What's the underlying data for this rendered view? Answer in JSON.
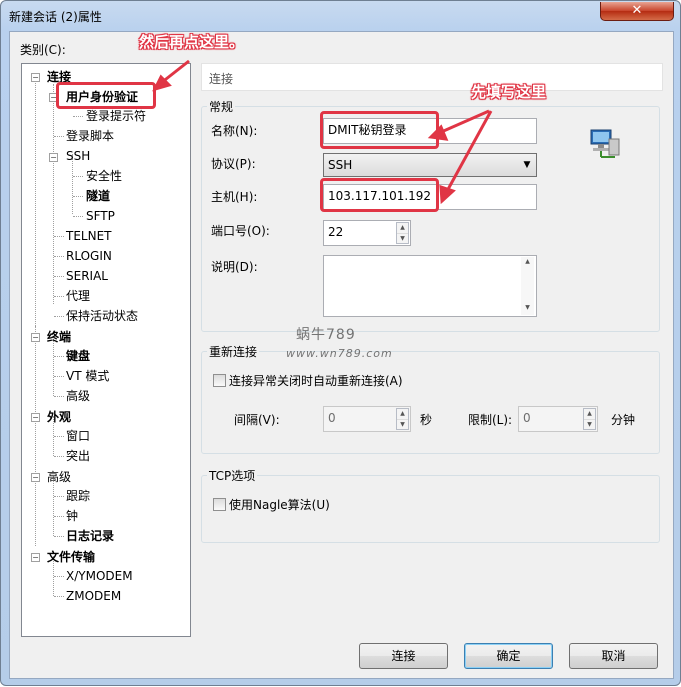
{
  "window": {
    "title": "新建会话 (2)属性",
    "close_glyph": "✕"
  },
  "category_label": "类别(C):",
  "tree": {
    "connection": "连接",
    "auth": "用户身份验证",
    "login_prompt": "登录提示符",
    "login_script": "登录脚本",
    "ssh": "SSH",
    "security": "安全性",
    "tunnel": "隧道",
    "sftp": "SFTP",
    "telnet": "TELNET",
    "rlogin": "RLOGIN",
    "serial": "SERIAL",
    "proxy": "代理",
    "keepalive": "保持活动状态",
    "terminal": "终端",
    "keyboard": "键盘",
    "vt_mode": "VT 模式",
    "advanced": "高级",
    "appearance": "外观",
    "window": "窗口",
    "highlight": "突出",
    "advanced2": "高级",
    "trace": "跟踪",
    "bell": "钟",
    "logging": "日志记录",
    "file_transfer": "文件传输",
    "xymodem": "X/YMODEM",
    "zmodem": "ZMODEM"
  },
  "panel": {
    "header": "连接",
    "general": {
      "title": "常规",
      "name_label": "名称(N):",
      "name_value": "DMIT秘钥登录",
      "protocol_label": "协议(P):",
      "protocol_value": "SSH",
      "host_label": "主机(H):",
      "host_value": "103.117.101.192",
      "port_label": "端口号(O):",
      "port_value": "22",
      "desc_label": "说明(D):",
      "desc_value": ""
    },
    "reconnect": {
      "title": "重新连接",
      "checkbox_label": "连接异常关闭时自动重新连接(A)",
      "interval_label": "间隔(V):",
      "interval_value": "0",
      "interval_unit": "秒",
      "limit_label": "限制(L):",
      "limit_value": "0",
      "limit_unit": "分钟"
    },
    "tcp": {
      "title": "TCP选项",
      "nagle_label": "使用Nagle算法(U)"
    }
  },
  "buttons": {
    "connect": "连接",
    "ok": "确定",
    "cancel": "取消"
  },
  "annotations": {
    "first": "先填写这里",
    "then": "然后再点这里。"
  },
  "watermark": {
    "line1": "蜗牛789",
    "line2": "www.wn789.com"
  },
  "colors": {
    "annotation_red": "#e03545"
  }
}
